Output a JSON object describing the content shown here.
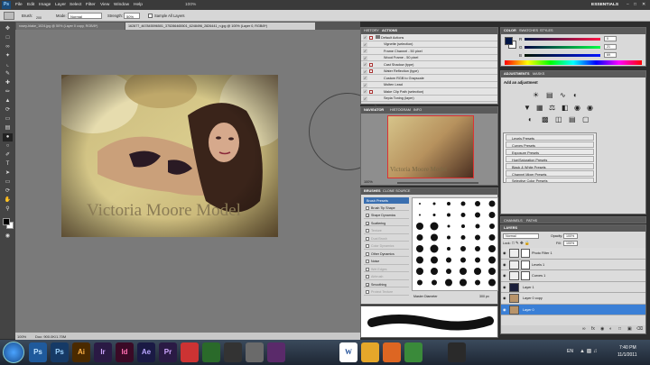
{
  "app": {
    "logo": "Ps",
    "workspace": "ESSENTIALS"
  },
  "menu": [
    "File",
    "Edit",
    "Image",
    "Layer",
    "Select",
    "Filter",
    "View",
    "Window",
    "Help"
  ],
  "options": {
    "brush_label": "Brush:",
    "brush_size": "200",
    "mode_label": "Mode:",
    "mode_value": "Normal",
    "strength_label": "Strength:",
    "strength_value": "50%",
    "sample_label": "Sample All Layers",
    "zoom": "100%"
  },
  "doc_tabs": [
    "rosey-blake_1024.jpg @ 50% (Layer 0 copy, RGB/8*)",
    "162877_467845596501_375286465501_6248496_2826441_n.jpg @ 100% (Layer 0, RGB/8*)"
  ],
  "photo": {
    "watermark": "Victoria Moore Model"
  },
  "status": {
    "zoom": "100%",
    "doc": "Doc: 900.0K/1.70M"
  },
  "actions": {
    "tabs": [
      "HISTORY",
      "ACTIONS"
    ],
    "set": "Default Actions",
    "items": [
      "Vignette (selection)",
      "Frame Channel - 50 pixel",
      "Wood Frame - 50 pixel",
      "Cast Shadow (type)",
      "Water Reflection (type)",
      "Custom RGB to Grayscale",
      "Molten Lead",
      "Make Clip Path (selection)",
      "Sepia Toning (layer)"
    ]
  },
  "navigator": {
    "tabs": [
      "NAVIGATOR",
      "HISTOGRAM",
      "INFO"
    ],
    "zoom": "100%"
  },
  "brushes": {
    "tabs": [
      "BRUSHES",
      "CLONE SOURCE"
    ],
    "presets_button": "Brush Presets",
    "options": [
      {
        "label": "Brush Tip Shape",
        "checked": false,
        "enabled": true
      },
      {
        "label": "Shape Dynamics",
        "checked": true,
        "enabled": true
      },
      {
        "label": "Scattering",
        "checked": true,
        "enabled": true
      },
      {
        "label": "Texture",
        "checked": false,
        "enabled": false
      },
      {
        "label": "Dual Brush",
        "checked": false,
        "enabled": false
      },
      {
        "label": "Color Dynamics",
        "checked": false,
        "enabled": false
      },
      {
        "label": "Other Dynamics",
        "checked": false,
        "enabled": true
      },
      {
        "label": "Noise",
        "checked": false,
        "enabled": true
      },
      {
        "label": "Wet Edges",
        "checked": false,
        "enabled": false
      },
      {
        "label": "Airbrush",
        "checked": false,
        "enabled": false
      },
      {
        "label": "Smoothing",
        "checked": true,
        "enabled": true
      },
      {
        "label": "Protect Texture",
        "checked": false,
        "enabled": false
      }
    ],
    "master_label": "Master Diameter",
    "master_value": "300 px"
  },
  "color": {
    "tabs": [
      "COLOR",
      "SWATCHES",
      "STYLES"
    ],
    "channels": [
      {
        "name": "R",
        "value": "0"
      },
      {
        "name": "G",
        "value": "21"
      },
      {
        "name": "B",
        "value": "69"
      }
    ]
  },
  "adjustments": {
    "tabs": [
      "ADJUSTMENTS",
      "MASKS"
    ],
    "title": "Add an adjustment",
    "presets": [
      "Levels Presets",
      "Curves Presets",
      "Exposure Presets",
      "Hue/Saturation Presets",
      "Black & White Presets",
      "Channel Mixer Presets",
      "Selective Color Presets"
    ]
  },
  "channels": {
    "tabs": [
      "CHANNELS",
      "PATHS"
    ]
  },
  "layers": {
    "tab": "LAYERS",
    "blend_mode": "Normal",
    "opacity_label": "Opacity:",
    "opacity_value": "100%",
    "lock_label": "Lock:",
    "fill_label": "Fill:",
    "fill_value": "100%",
    "items": [
      {
        "name": "Photo Filter 1",
        "selected": false
      },
      {
        "name": "Levels 1",
        "selected": false
      },
      {
        "name": "Curves 1",
        "selected": false
      },
      {
        "name": "Layer 1",
        "selected": false
      },
      {
        "name": "Layer 0 copy",
        "selected": false
      },
      {
        "name": "Layer 0",
        "selected": true
      }
    ]
  },
  "taskbar": {
    "apps": [
      "Ps",
      "Ps",
      "Ai",
      "Ir",
      "Id",
      "Ae",
      "Pr",
      "",
      "",
      "",
      "",
      "",
      "W",
      "",
      "",
      "",
      ""
    ],
    "language": "EN",
    "time": "7:40 PM",
    "date": "11/1/2011"
  }
}
